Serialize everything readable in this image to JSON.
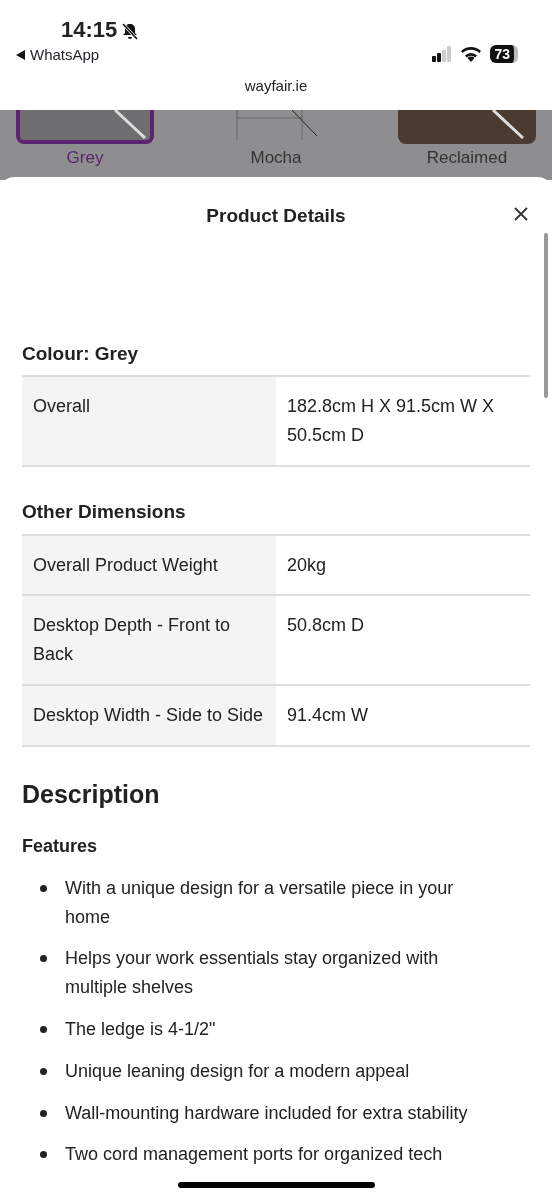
{
  "status_bar": {
    "time": "14:15",
    "back_app": "WhatsApp",
    "battery": "73",
    "muted": true
  },
  "browser": {
    "url": "wayfair.ie"
  },
  "swatches": [
    {
      "label": "Grey",
      "selected": true,
      "kind": "grey"
    },
    {
      "label": "Mocha",
      "selected": false,
      "kind": "frame"
    },
    {
      "label": "Reclaimed",
      "selected": false,
      "kind": "wood"
    }
  ],
  "sheet": {
    "title": "Product Details",
    "sections": [
      {
        "heading": "Colour: Grey",
        "rows": [
          {
            "label": "Overall",
            "value": "182.8cm H X 91.5cm W X 50.5cm D"
          }
        ]
      },
      {
        "heading": "Other Dimensions",
        "rows": [
          {
            "label": "Overall Product Weight",
            "value": "20kg"
          },
          {
            "label": "Desktop Depth - Front to Back",
            "value": "50.8cm D"
          },
          {
            "label": "Desktop Width - Side to Side",
            "value": "91.4cm W"
          }
        ]
      }
    ],
    "description": {
      "heading": "Description",
      "subheading": "Features",
      "features": [
        "With a unique design for a versatile piece in your home",
        "Helps your work essentials stay organized with multiple shelves",
        "The ledge is 4-1/2\"",
        "Unique leaning design for a modern appeal",
        "Wall-mounting hardware included for extra stability",
        "Two cord management ports for organized tech"
      ]
    }
  }
}
